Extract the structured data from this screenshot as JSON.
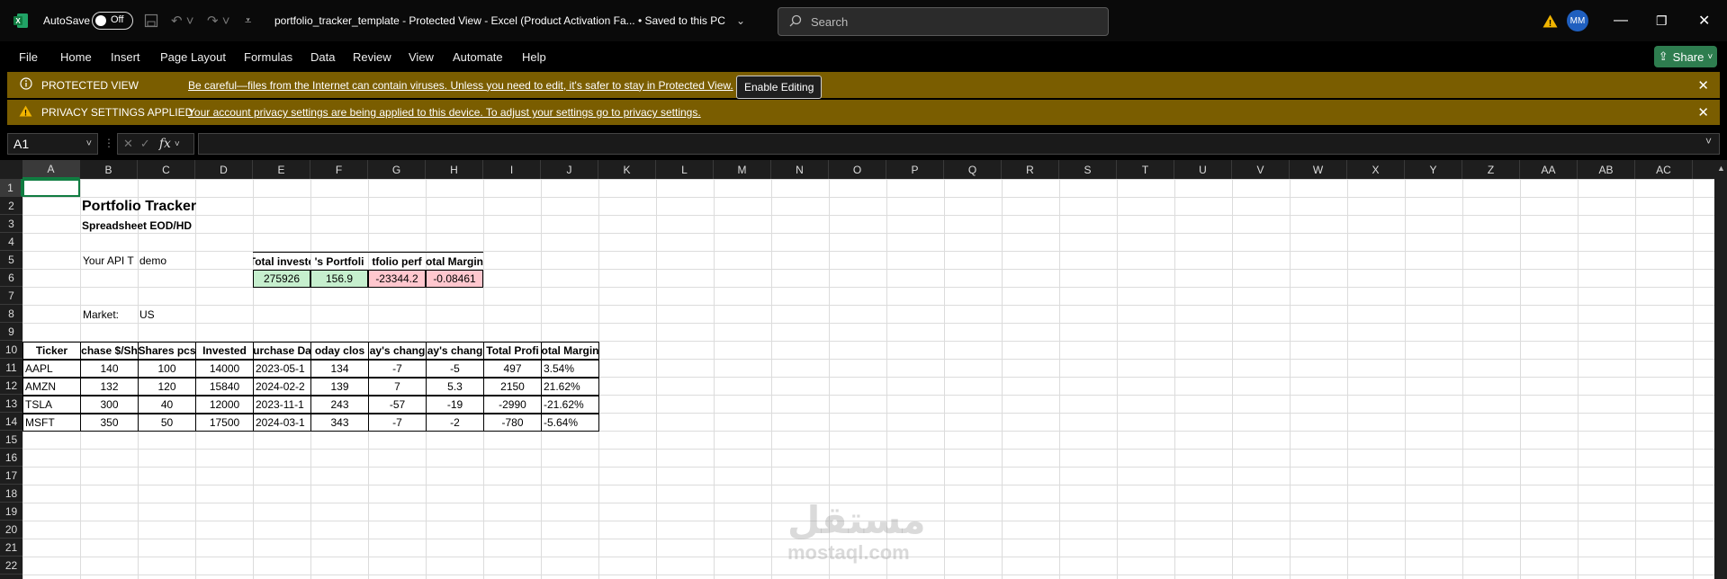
{
  "titlebar": {
    "autosave_label": "AutoSave",
    "autosave_state": "Off",
    "doc_title": "portfolio_tracker_template  -  Protected View  -  Excel (Product Activation Fa...  •  Saved to this PC",
    "search_placeholder": "Search",
    "user_initials": "MM"
  },
  "menu": {
    "items": [
      "File",
      "Home",
      "Insert",
      "Page Layout",
      "Formulas",
      "Data",
      "Review",
      "View",
      "Automate",
      "Help"
    ],
    "share_label": "Share"
  },
  "protected_bar": {
    "title": "PROTECTED VIEW",
    "message": "Be careful—files from the Internet can contain viruses. Unless you need to edit, it's safer to stay in Protected View.",
    "button": "Enable Editing"
  },
  "privacy_bar": {
    "title": "PRIVACY SETTINGS APPLIED",
    "message": "Your account privacy settings are being applied to this device. To adjust your settings go to privacy settings."
  },
  "formula_bar": {
    "name_box": "A1",
    "fx": "fx",
    "content": ""
  },
  "columns": [
    "A",
    "B",
    "C",
    "D",
    "E",
    "F",
    "G",
    "H",
    "I",
    "J",
    "K",
    "L",
    "M",
    "N",
    "O",
    "P",
    "Q",
    "R",
    "S",
    "T",
    "U",
    "V",
    "W",
    "X",
    "Y",
    "Z",
    "AA",
    "AB",
    "AC"
  ],
  "rows": [
    "1",
    "2",
    "3",
    "4",
    "5",
    "6",
    "7",
    "8",
    "9",
    "10",
    "11",
    "12",
    "13",
    "14",
    "15",
    "16",
    "17",
    "18",
    "19",
    "20",
    "21",
    "22"
  ],
  "sheet": {
    "title": "Portfolio Tracker",
    "subtitle": "Spreadsheet EOD/HD",
    "api_label": "Your API T",
    "api_value": "demo",
    "summary_headers": [
      "Total investe",
      "'s Portfoli",
      "tfolio perf",
      "otal Margin"
    ],
    "summary_values": [
      "275926",
      "156.9",
      "-23344.2",
      "-0.08461"
    ],
    "market_label": "Market:",
    "market_value": "US",
    "table_headers": [
      "Ticker",
      "chase $/Sh",
      "Shares pcs",
      "Invested",
      "urchase Da",
      "oday clos",
      "ay's chang",
      "ay's chang",
      "Total Profi",
      "otal Margin"
    ],
    "table_rows": [
      [
        "AAPL",
        "140",
        "100",
        "14000",
        "2023-05-1",
        "134",
        "-7",
        "-5",
        "497",
        "3.54%"
      ],
      [
        "AMZN",
        "132",
        "120",
        "15840",
        "2024-02-2",
        "139",
        "7",
        "5.3",
        "2150",
        "21.62%"
      ],
      [
        "TSLA",
        "300",
        "40",
        "12000",
        "2023-11-1",
        "243",
        "-57",
        "-19",
        "-2990",
        "-21.62%"
      ],
      [
        "MSFT",
        "350",
        "50",
        "17500",
        "2024-03-1",
        "343",
        "-7",
        "-2",
        "-780",
        "-5.64%"
      ]
    ]
  },
  "watermark": {
    "arabic": "مستقل",
    "latin": "mostaql.com"
  },
  "colors": {
    "accent_green": "#2e7d4f",
    "bar_yellow": "#7a5d00",
    "cell_green": "#c6efce",
    "cell_red": "#ffc7ce"
  }
}
